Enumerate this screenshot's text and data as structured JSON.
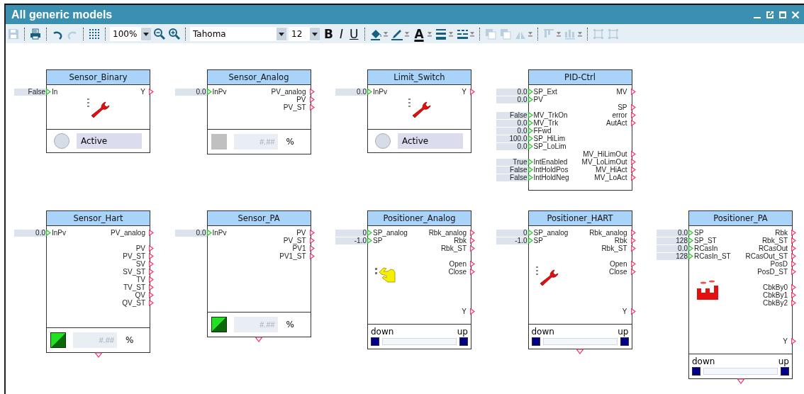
{
  "window": {
    "title": "All generic models"
  },
  "toolbar": [
    {
      "kind": "save",
      "disabled": true
    },
    {
      "kind": "separator"
    },
    {
      "kind": "print",
      "disabled": false
    },
    {
      "kind": "separator"
    },
    {
      "kind": "undo",
      "disabled": false
    },
    {
      "kind": "redo",
      "disabled": true
    },
    {
      "kind": "separator"
    },
    {
      "kind": "grid",
      "disabled": false
    },
    {
      "kind": "separator"
    },
    {
      "kind": "zoom_select",
      "value": "100%"
    },
    {
      "kind": "zoom_out",
      "disabled": false
    },
    {
      "kind": "zoom_in",
      "disabled": false
    },
    {
      "kind": "separator"
    },
    {
      "kind": "font_select",
      "value": "Tahoma"
    },
    {
      "kind": "size_select",
      "value": "12"
    },
    {
      "kind": "bold",
      "label": "B"
    },
    {
      "kind": "italic",
      "label": "I"
    },
    {
      "kind": "underline",
      "label": "U"
    },
    {
      "kind": "separator"
    },
    {
      "kind": "fill",
      "disabled": false
    },
    {
      "kind": "pen",
      "disabled": false
    },
    {
      "kind": "text_color",
      "label": "A"
    },
    {
      "kind": "line_weight",
      "disabled": false
    },
    {
      "kind": "line_style",
      "disabled": false
    },
    {
      "kind": "separator"
    },
    {
      "kind": "bring_front",
      "disabled": true
    },
    {
      "kind": "send_back",
      "disabled": true
    },
    {
      "kind": "flip",
      "disabled": true
    },
    {
      "kind": "separator"
    },
    {
      "kind": "align",
      "disabled": true
    },
    {
      "kind": "distribute",
      "disabled": true
    },
    {
      "kind": "separator"
    },
    {
      "kind": "group",
      "disabled": true
    },
    {
      "kind": "ungroup",
      "disabled": true
    }
  ],
  "rows": [
    [
      {
        "title": "Sensor_Binary",
        "icon": {
          "kind": "wrench"
        },
        "ports": [
          {
            "in": {
              "value": "False",
              "name": "In"
            },
            "out": "Y"
          }
        ],
        "footer": {
          "kind": "status",
          "text": "Active"
        }
      },
      {
        "title": "Sensor_Analog",
        "ports": [
          {
            "in": {
              "value": "0.0",
              "name": "InPv"
            },
            "out": "PV_analog"
          },
          {
            "out": "PV"
          },
          {
            "out": "PV_ST"
          }
        ],
        "footer": {
          "kind": "value",
          "swatch_on": false,
          "placeholder": "#.##",
          "unit": "%"
        }
      },
      {
        "title": "Limit_Switch",
        "icon": {
          "kind": "wrench"
        },
        "ports": [
          {
            "in": {
              "value": "0.0",
              "name": "InPv"
            },
            "out": "Y"
          }
        ],
        "footer": {
          "kind": "status",
          "text": "Active"
        }
      },
      {
        "title": "PID-Ctrl",
        "ports": [
          {
            "in": {
              "value": "0.0",
              "name": "SP_Ext"
            },
            "out": "MV"
          },
          {
            "in": {
              "value": "0.0",
              "name": "PV"
            }
          },
          {
            "out": "SP"
          },
          {
            "in": {
              "value": "False",
              "name": "MV_TrkOn"
            },
            "out": "error"
          },
          {
            "in": {
              "value": "0.0",
              "name": "MV_Trk"
            },
            "out": "AutAct"
          },
          {
            "in": {
              "value": "0.0",
              "name": "FFwd"
            }
          },
          {
            "in": {
              "value": "100.0",
              "name": "SP_HiLim"
            }
          },
          {
            "in": {
              "value": "0.0",
              "name": "SP_LoLim"
            }
          },
          {
            "out": "MV_HiLimOut"
          },
          {
            "in": {
              "value": "True",
              "name": "IntEnabled"
            },
            "out": "MV_LoLimOut"
          },
          {
            "in": {
              "value": "False",
              "name": "IntHoldPos"
            },
            "out": "MV_HiAct"
          },
          {
            "in": {
              "value": "False",
              "name": "IntHoldNeg"
            },
            "out": "MV_LoAct"
          }
        ]
      }
    ],
    [
      {
        "title": "Sensor_Hart",
        "bottom_port": true,
        "ports": [
          {
            "in": {
              "value": "0.0",
              "name": "InPv"
            },
            "out": "PV_analog"
          },
          {
            "out": "PV",
            "gap_before": true
          },
          {
            "out": "PV_ST"
          },
          {
            "out": "SV"
          },
          {
            "out": "SV_ST"
          },
          {
            "out": "TV"
          },
          {
            "out": "TV_ST"
          },
          {
            "out": "QV"
          },
          {
            "out": "QV_ST"
          }
        ],
        "footer": {
          "kind": "value",
          "swatch_on": true,
          "placeholder": "#.##",
          "unit": "%"
        }
      },
      {
        "title": "Sensor_PA",
        "bottom_port": true,
        "ports": [
          {
            "in": {
              "value": "0.0",
              "name": "InPv"
            },
            "out": "PV"
          },
          {
            "out": "PV_ST"
          },
          {
            "out": "PV1"
          },
          {
            "out": "PV1_ST"
          }
        ],
        "footer": {
          "kind": "value",
          "swatch_on": true,
          "placeholder": "#.##",
          "unit": "%"
        }
      },
      {
        "title": "Positioner_Analog",
        "icon": {
          "kind": "hand"
        },
        "ports": [
          {
            "in": {
              "value": "0",
              "name": "SP_analog"
            },
            "out": "Rbk_analog"
          },
          {
            "in": {
              "value": "-1.0",
              "name": "SP"
            },
            "out": "Rbk"
          },
          {
            "out": "Rbk_ST"
          },
          {
            "out": "Open",
            "gap_before": true
          },
          {
            "out": "Close"
          }
        ],
        "bottom_outputs": [
          "Y"
        ],
        "footer": {
          "kind": "slider",
          "low": "down",
          "high": "up"
        }
      },
      {
        "title": "Positioner_HART",
        "icon": {
          "kind": "wrench"
        },
        "bottom_port": true,
        "ports": [
          {
            "in": {
              "value": "0",
              "name": "SP_analog"
            },
            "out": "Rbk_analog"
          },
          {
            "in": {
              "value": "-1.0",
              "name": "SP"
            },
            "out": "Rbk"
          },
          {
            "out": "Rbk_ST"
          },
          {
            "out": "Open",
            "gap_before": true
          },
          {
            "out": "Close"
          }
        ],
        "bottom_outputs": [
          "Y"
        ],
        "footer": {
          "kind": "slider",
          "low": "down",
          "high": "up"
        }
      },
      {
        "title": "Positioner_PA",
        "icon": {
          "kind": "factory"
        },
        "bottom_port": true,
        "ports": [
          {
            "in": {
              "value": "0.0",
              "name": "SP"
            },
            "out": "Rbk"
          },
          {
            "in": {
              "value": "128",
              "name": "SP_ST"
            },
            "out": "Rbk_ST"
          },
          {
            "in": {
              "value": "0.0",
              "name": "RCasIn"
            },
            "out": "RCasOut"
          },
          {
            "in": {
              "value": "128",
              "name": "RCasIn_ST"
            },
            "out": "RCasOut_ST"
          },
          {
            "out": "PosD"
          },
          {
            "out": "PosD_ST"
          },
          {
            "out": "CbkBy0",
            "gap_before": true
          },
          {
            "out": "CbkBy1"
          },
          {
            "out": "CbkBy2"
          }
        ],
        "bottom_outputs": [
          "Y"
        ],
        "footer": {
          "kind": "slider",
          "low": "down",
          "high": "up"
        }
      }
    ]
  ]
}
